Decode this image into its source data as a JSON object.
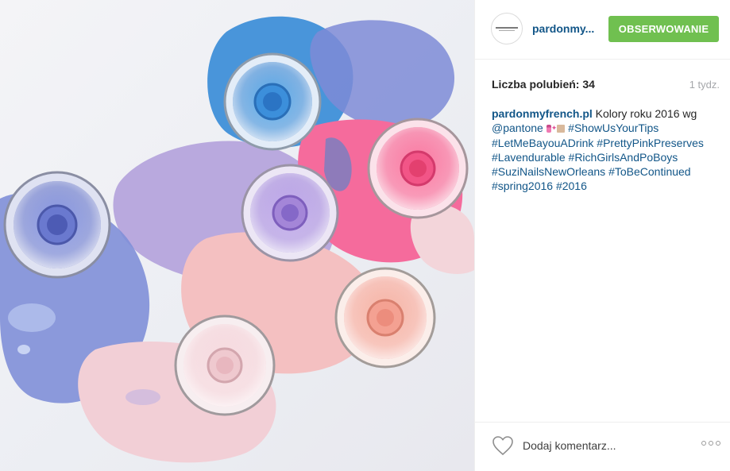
{
  "post": {
    "image": {
      "subject": "",
      "colors": {
        "background": "#eef0f4",
        "blue": "#3f8fd8",
        "periwinkle": "#6f7ac8",
        "lavender": "#b7a6dc",
        "violet": "#a78bd6",
        "pink": "#f06a9a",
        "rose_quartz": "#f3c1c0",
        "peach": "#f2aa9f",
        "pale_pink": "#f2d6dc"
      }
    },
    "header": {
      "avatar_icon": "pardonmyfrench-logo-avatar",
      "username": "pardonmy...",
      "follow_label": "OBSERWOWANIE",
      "follow_color": "#70c050"
    },
    "stats": {
      "likes": "Liczba polubień: 34",
      "time_ago": "1 tydz."
    },
    "caption": {
      "author": "pardonmyfrench.pl",
      "text": " Kolory roku 2016 wg ",
      "mention": "@pantone",
      "hashtags": [
        "#ShowUsYourTips",
        "#LetMeBayouADrink",
        "#PrettyPinkPreserves",
        "#Lavendurable",
        "#RichGirlsAndPoBoys",
        "#SuziNailsNewOrleans",
        "#ToBeContinued",
        "#spring2016",
        "#2016"
      ],
      "emojis": [
        "nail-polish-emoji",
        "sparkles-emoji",
        "beige-square-emoji"
      ]
    },
    "footer": {
      "like_icon": "heart-icon",
      "comment_placeholder": "Dodaj komentarz...",
      "more_icon": "more-options-icon"
    },
    "link_color": "#125688"
  }
}
